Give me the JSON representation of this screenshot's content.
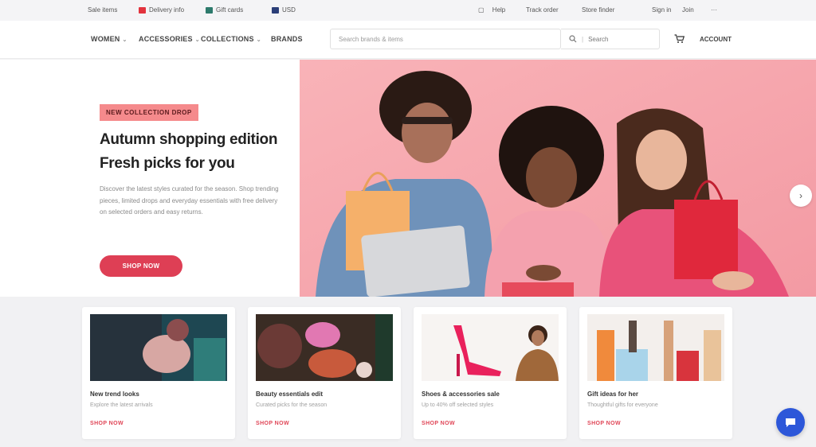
{
  "topbar": {
    "util_1": "Sale items",
    "util_2": "Delivery info",
    "util_3": "Gift cards",
    "util_4": "USD",
    "right_1": "Help",
    "right_2": "Track order",
    "right_3": "Store finder",
    "right_4": "Sign in",
    "right_5": "Join",
    "right_6": "···"
  },
  "nav": {
    "categories": [
      {
        "label": "WOMEN"
      },
      {
        "label": "ACCESSORIES"
      },
      {
        "label": "COLLECTIONS"
      },
      {
        "label": "BRANDS"
      }
    ],
    "search_placeholder": "Search brands & items",
    "search_button_label": "Search",
    "account_label": "ACCOUNT"
  },
  "hero": {
    "badge": "NEW COLLECTION DROP",
    "title_line1": "Autumn shopping edition",
    "title_line2": "Fresh picks for you",
    "description": "Discover the latest styles curated for the season. Shop trending pieces, limited drops and everyday essentials with free delivery on selected orders and easy returns.",
    "cta_label": "SHOP NOW"
  },
  "cards": [
    {
      "title": "New trend looks",
      "subtitle": "Explore the latest arrivals",
      "link": "SHOP NOW"
    },
    {
      "title": "Beauty essentials edit",
      "subtitle": "Curated picks for the season",
      "link": "SHOP NOW"
    },
    {
      "title": "Shoes & accessories sale",
      "subtitle": "Up to 40% off selected styles",
      "link": "SHOP NOW"
    },
    {
      "title": "Gift ideas for her",
      "subtitle": "Thoughtful gifts for everyone",
      "link": "SHOP NOW"
    }
  ],
  "icons": {
    "search": "search-icon",
    "cart": "cart-icon",
    "next": "chevron-right-icon",
    "chat": "chat-icon"
  },
  "colors": {
    "accent": "#de3f55",
    "hero_bg": "#f6a7ae",
    "badge_bg": "#f58a8c",
    "chat": "#2d57d9"
  }
}
